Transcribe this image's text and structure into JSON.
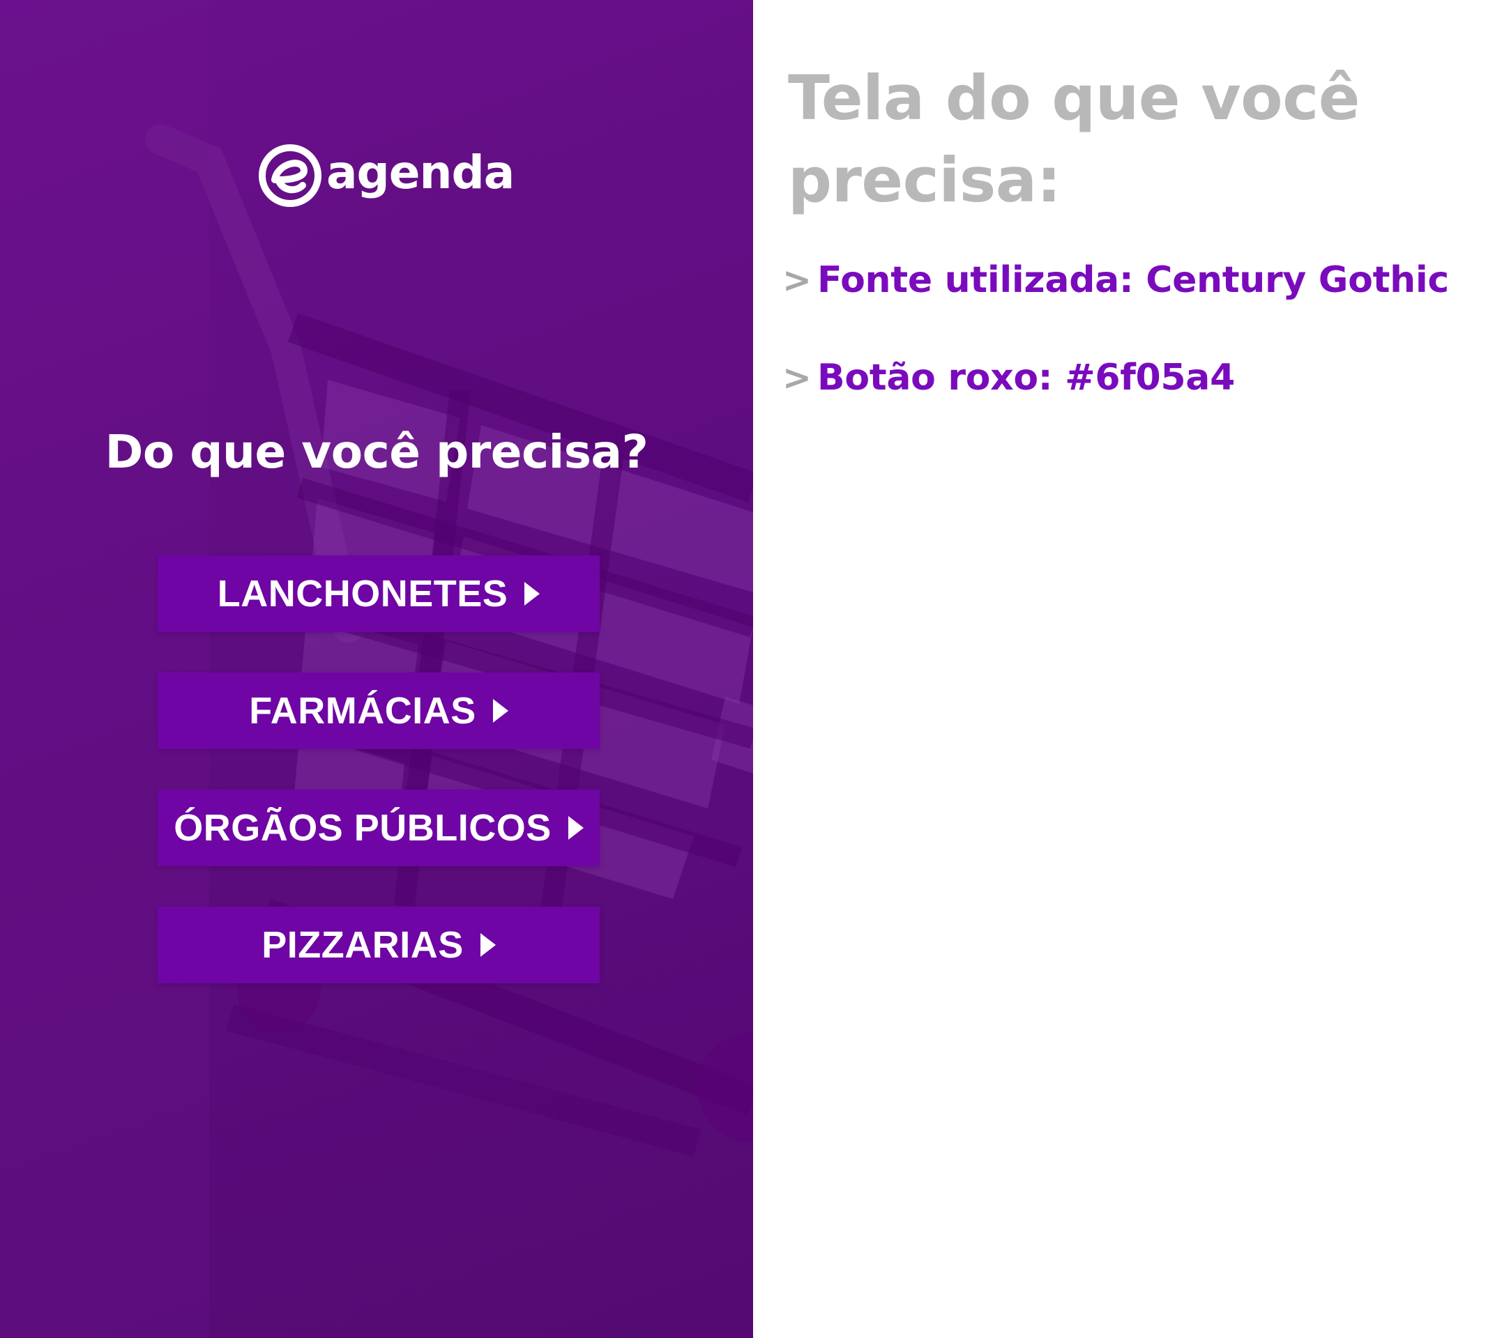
{
  "colors": {
    "panel_background": "#5e0d80",
    "button_background": "#6f05a4",
    "button_text": "#ffffff",
    "title_gray": "#b8b8b8",
    "spec_purple": "#7a0bbd",
    "bullet_gray": "#a8a8a8"
  },
  "app": {
    "logo_text": "agenda",
    "logo_icon": "e-circle-logo-icon",
    "question": "Do que você precisa?"
  },
  "menu": {
    "items": [
      {
        "label": "LANCHONETES",
        "icon": "arrow-right-icon"
      },
      {
        "label": "FARMÁCIAS",
        "icon": "arrow-right-icon"
      },
      {
        "label": "ÓRGÃOS PÚBLICOS",
        "icon": "arrow-right-icon"
      },
      {
        "label": "PIZZARIAS",
        "icon": "arrow-right-icon"
      }
    ]
  },
  "spec": {
    "title": "Tela do que você precisa:",
    "items": [
      {
        "bullet": ">",
        "text": "Fonte utilizada: Century Gothic"
      },
      {
        "bullet": ">",
        "text": "Botão roxo: #6f05a4"
      }
    ]
  }
}
